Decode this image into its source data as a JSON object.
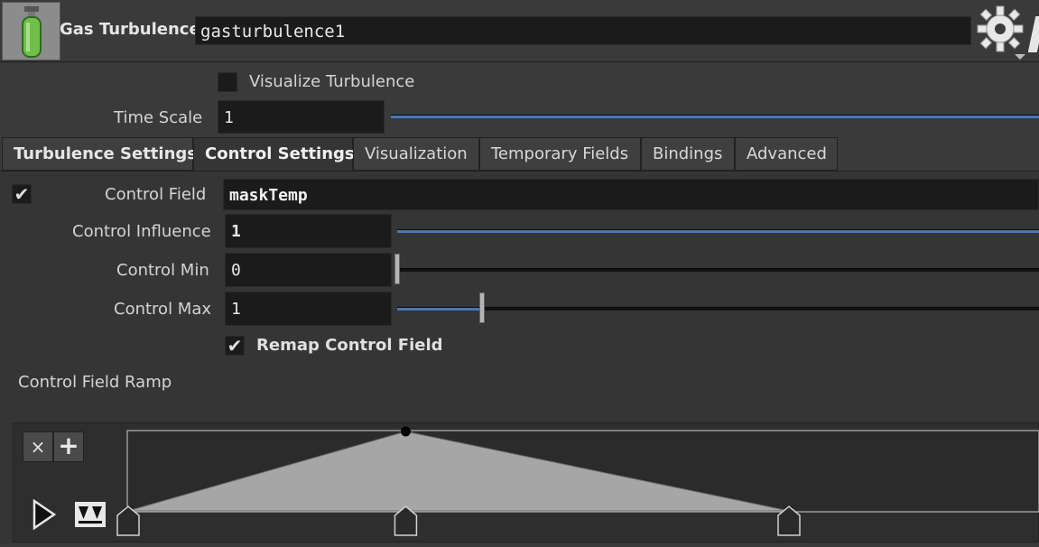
{
  "header": {
    "node_type": "Gas Turbulence",
    "node_name": "gasturbulence1"
  },
  "visualize": {
    "label": "Visualize Turbulence",
    "checked": false
  },
  "time_scale": {
    "label": "Time Scale",
    "value": "1"
  },
  "tabs": [
    {
      "label": "Turbulence Settings",
      "active": false
    },
    {
      "label": "Control Settings",
      "active": true
    },
    {
      "label": "Visualization",
      "active": false
    },
    {
      "label": "Temporary Fields",
      "active": false
    },
    {
      "label": "Bindings",
      "active": false
    },
    {
      "label": "Advanced",
      "active": false
    }
  ],
  "control": {
    "field_label": "Control Field",
    "field_value": "maskTemp",
    "field_enabled": true,
    "influence_label": "Control Influence",
    "influence_value": "1",
    "min_label": "Control Min",
    "min_value": "0",
    "max_label": "Control Max",
    "max_value": "1",
    "remap_label": "Remap Control Field",
    "remap_checked": true
  },
  "ramp": {
    "label": "Control Field Ramp",
    "remove_glyph": "×",
    "add_glyph": "+",
    "play_icon": "play-icon",
    "keys": [
      {
        "pos": 0.0,
        "value": 0.0,
        "selected": true
      },
      {
        "pos": 0.42,
        "value": 1.0,
        "selected": false
      },
      {
        "pos": 1.0,
        "value": 0.0,
        "selected": false
      }
    ]
  },
  "colors": {
    "slider_fill": "#4a78b8",
    "selected_key": "#d9a030",
    "ramp_fill": "#a6a6a6"
  }
}
